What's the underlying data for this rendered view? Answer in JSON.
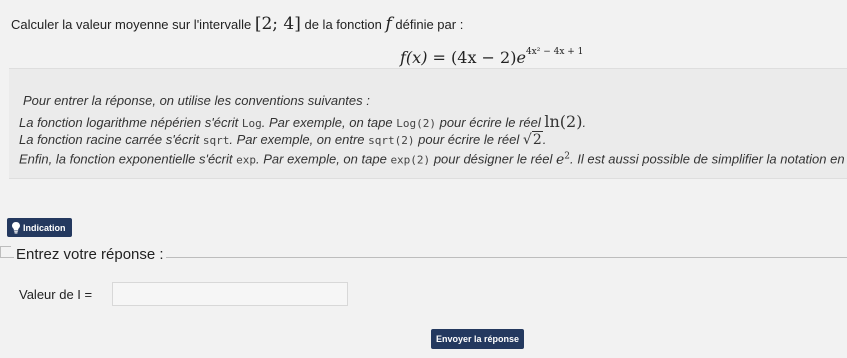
{
  "question": {
    "before_interval": "Calculer la valeur moyenne sur l'intervalle",
    "interval": "[2; 4]",
    "middle": "de la fonction",
    "func_name": "f",
    "after": "définie par :"
  },
  "formula": {
    "lhs": "f(x)",
    "equals": " = (4x − 2)",
    "base": "e",
    "exponent": "4x² − 4x + 1"
  },
  "info": {
    "line1": "Pour entrer la réponse, on utilise les conventions suivantes :",
    "line2_a": "La fonction logarithme népérien s'écrit",
    "line2_code": "Log",
    "line2_b": ". Par exemple, on tape",
    "line2_code2": "Log(2)",
    "line2_c": "pour écrire le réel",
    "line2_math": "ln(2)",
    "line2_end": ".",
    "line3_a": "La fonction racine carrée s'écrit",
    "line3_code": "sqrt",
    "line3_b": ". Par exemple, on entre",
    "line3_code2": "sqrt(2)",
    "line3_c": "pour écrire le réel",
    "line3_math_root": "√",
    "line3_math_rad": "2",
    "line3_end": ".",
    "line4_a": "Enfin, la fonction exponentielle s'écrit",
    "line4_code": "exp",
    "line4_b": ". Par exemple, on tape",
    "line4_code2": "exp(2)",
    "line4_c": "pour désigner le réel",
    "line4_math_base": "e",
    "line4_math_exp": "2",
    "line4_d": ". Il est aussi possible de simplifier la notation en écrivar"
  },
  "hint": {
    "label": "Indication"
  },
  "answer": {
    "legend": "Entrez votre réponse :",
    "label": "Valeur de I =",
    "value": "",
    "submit": "Envoyer la réponse"
  }
}
